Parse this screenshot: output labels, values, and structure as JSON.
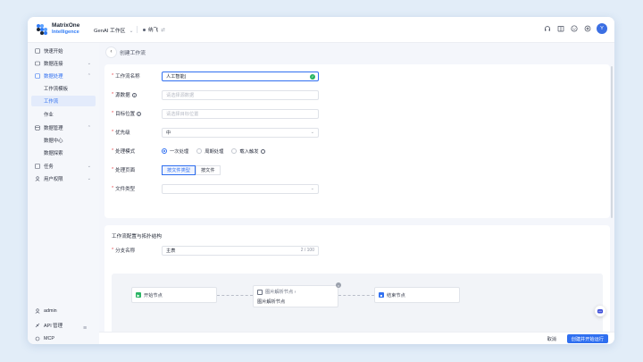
{
  "brand": {
    "line1": "MatrixOne",
    "line2": "Intelligence"
  },
  "topbar": {
    "workspace": "GenAI 工作区",
    "workspace_chevron": "⌄",
    "project": "纳飞",
    "project_icon": "⇄",
    "avatar": "Y",
    "tools": [
      "headset-icon",
      "book-icon",
      "emoji-icon",
      "settings-icon"
    ]
  },
  "sidebar": {
    "items": [
      {
        "label": "快速开始",
        "icon": "rocket-icon"
      },
      {
        "label": "数据连接",
        "icon": "link-icon",
        "caret": "⌄"
      },
      {
        "label": "数据处理",
        "icon": "process-icon",
        "caret": "⌃"
      },
      {
        "label": "工作流模板"
      },
      {
        "label": "工作流"
      },
      {
        "label": "作业"
      },
      {
        "label": "数据管理",
        "icon": "db-icon",
        "caret": "⌃"
      },
      {
        "label": "数据中心"
      },
      {
        "label": "数据探索"
      },
      {
        "label": "任务",
        "icon": "task-icon",
        "caret": "⌄"
      },
      {
        "label": "用户权限",
        "icon": "user-icon",
        "caret": "⌄"
      }
    ],
    "bottom": [
      {
        "label": "admin",
        "icon": "person-icon"
      },
      {
        "label": "API 管理",
        "icon": "api-icon"
      },
      {
        "label": "MCP",
        "icon": "mcp-icon"
      }
    ],
    "collapse": "≡"
  },
  "page": {
    "back": "‹",
    "title": "创建工作流"
  },
  "form": {
    "name": {
      "label": "工作流名称",
      "value": "人工智能|"
    },
    "source": {
      "label": "源数据",
      "placeholder": "请选择源数据"
    },
    "target": {
      "label": "目标位置",
      "placeholder": "请选择目标位置"
    },
    "priority": {
      "label": "优先级",
      "value": "中"
    },
    "mode": {
      "label": "处理模式",
      "options": [
        "一次处理",
        "周期处理",
        "载入触发"
      ]
    },
    "page_type": {
      "label": "处理页面",
      "options": [
        "按文件类型",
        "按文件"
      ]
    },
    "file_type": {
      "label": "文件类型"
    }
  },
  "config": {
    "title": "工作流配置与拓扑结构",
    "branch_label": "分支名称",
    "branch_value": "主表",
    "counter": "2 / 100"
  },
  "graph": {
    "start": "开始节点",
    "parser_header": "图片解析节点 ›",
    "parser_body": "图片解析节点",
    "end": "结束节点"
  },
  "footer": {
    "cancel": "取消",
    "submit": "创建并开始运行"
  },
  "colors": {
    "accent": "#2f6ff0",
    "success": "#28b463",
    "required": "#e5484d"
  }
}
